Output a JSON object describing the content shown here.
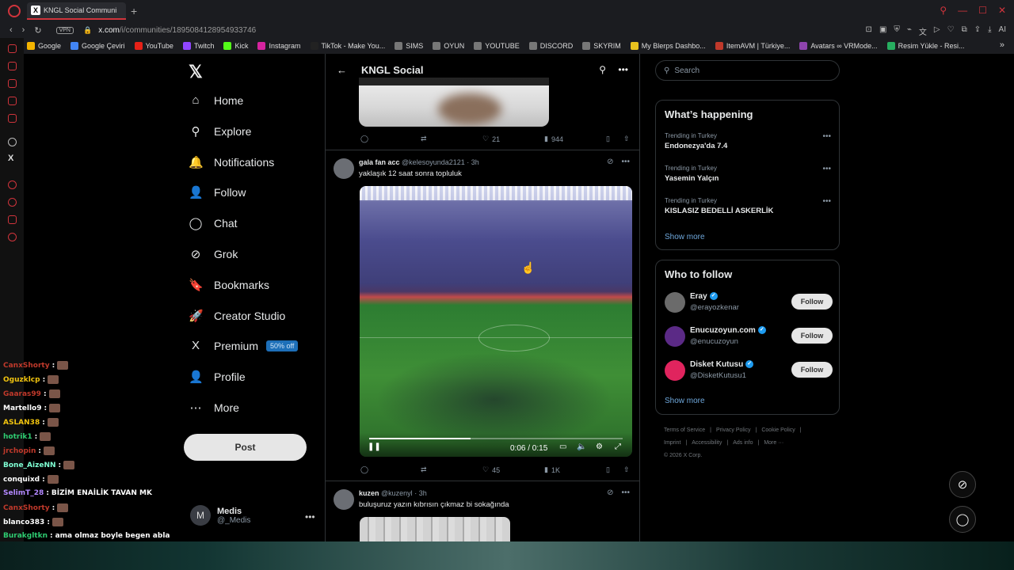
{
  "browser": {
    "tab_title": "KNGL Social Communi",
    "url_main": "x.com",
    "url_rest": "/i/communities/1895084128954933746",
    "vpn_label": "VPN",
    "ai_label": "AI",
    "bookmarks": [
      {
        "label": "Google",
        "color": "#f4b400"
      },
      {
        "label": "Google Çeviri",
        "color": "#4285f4"
      },
      {
        "label": "YouTube",
        "color": "#e62117"
      },
      {
        "label": "Twitch",
        "color": "#9146ff"
      },
      {
        "label": "Kick",
        "color": "#53fc18"
      },
      {
        "label": "Instagram",
        "color": "#d6249f"
      },
      {
        "label": "TikTok - Make You...",
        "color": "#222222"
      },
      {
        "label": "SIMS",
        "color": "#777777"
      },
      {
        "label": "OYUN",
        "color": "#777777"
      },
      {
        "label": "YOUTUBE",
        "color": "#777777"
      },
      {
        "label": "DISCORD",
        "color": "#777777"
      },
      {
        "label": "SKYRIM",
        "color": "#777777"
      },
      {
        "label": "My Blerps Dashbo...",
        "color": "#e8c21e"
      },
      {
        "label": "ItemAVM | Türkiye...",
        "color": "#c0392b"
      },
      {
        "label": "Avatars ∞ VRMode...",
        "color": "#8e44ad"
      },
      {
        "label": "Resim Yükle - Resi...",
        "color": "#27ae60"
      }
    ]
  },
  "nav": {
    "items": [
      {
        "label": "Home",
        "icon": "home-icon",
        "glyph": "⌂"
      },
      {
        "label": "Explore",
        "icon": "search-icon",
        "glyph": "⚲"
      },
      {
        "label": "Notifications",
        "icon": "bell-icon",
        "glyph": "🔔"
      },
      {
        "label": "Follow",
        "icon": "follow-icon",
        "glyph": "👤"
      },
      {
        "label": "Chat",
        "icon": "chat-icon",
        "glyph": "◯"
      },
      {
        "label": "Grok",
        "icon": "grok-icon",
        "glyph": "⊘"
      },
      {
        "label": "Bookmarks",
        "icon": "bookmark-icon",
        "glyph": "🔖"
      },
      {
        "label": "Creator Studio",
        "icon": "rocket-icon",
        "glyph": "🚀"
      },
      {
        "label": "Premium",
        "icon": "x-icon",
        "glyph": "X"
      },
      {
        "label": "Profile",
        "icon": "profile-icon",
        "glyph": "👤"
      },
      {
        "label": "More",
        "icon": "more-icon",
        "glyph": "⋯"
      }
    ],
    "premium_badge": "50% off",
    "post_label": "Post",
    "account_name": "Medis",
    "account_handle": "@_Medis",
    "account_initial": "M"
  },
  "timeline": {
    "header_title": "KNGL Social",
    "top_post_stats": {
      "likes": "21",
      "views": "944"
    },
    "tweet1": {
      "name": "gala fan acc",
      "handle": "@kelesoyunda2121",
      "time": "· 3h",
      "text": "yaklaşık 12 saat sonra topluluk",
      "video_time": "0:06 / 0:15",
      "progress": 0.4,
      "likes": "45",
      "views": "1K"
    },
    "tweet2": {
      "name": "kuzen",
      "handle": "@kuzenyl",
      "time": "· 3h",
      "text": "buluşuruz yazın kıbrısın çıkmaz bi sokağında"
    }
  },
  "right": {
    "search_placeholder": "Search",
    "whats_happening": "What’s happening",
    "trends": [
      {
        "context": "Trending in Turkey",
        "title": "Endonezya'da 7.4"
      },
      {
        "context": "Trending in Turkey",
        "title": "Yasemin Yalçın"
      },
      {
        "context": "Trending in Turkey",
        "title": "KISLASIZ BEDELLİ ASKERLİK"
      }
    ],
    "show_more": "Show more",
    "who_to_follow": "Who to follow",
    "follow_label": "Follow",
    "suggestions": [
      {
        "name": "Eray",
        "handle": "@erayozkenar",
        "color": "#6b6b6b"
      },
      {
        "name": "Enucuzoyun.com",
        "handle": "@enucuzoyun",
        "color": "#5b2a86"
      },
      {
        "name": "Disket Kutusu",
        "handle": "@DisketKutusu1",
        "color": "#e0245e"
      }
    ],
    "footer": [
      "Terms of Service",
      "|",
      "Privacy Policy",
      "|",
      "Cookie Policy",
      "|",
      "Imprint",
      "|",
      "Accessibility",
      "|",
      "Ads info",
      "|",
      "More ···",
      "© 2026 X Corp."
    ]
  },
  "chat": [
    {
      "user": "CanxShorty",
      "color": "#c0392b",
      "msg": ""
    },
    {
      "user": "Oguzklcp",
      "color": "#f1c40f",
      "msg": ""
    },
    {
      "user": "Gaaras99",
      "color": "#c0392b",
      "msg": ""
    },
    {
      "user": "Martello9",
      "color": "#ffffff",
      "msg": ""
    },
    {
      "user": "ASLAN38",
      "color": "#f1c40f",
      "msg": ""
    },
    {
      "user": "hotrik1",
      "color": "#2ecc71",
      "msg": ""
    },
    {
      "user": "jrchopin",
      "color": "#c0392b",
      "msg": ""
    },
    {
      "user": "Bone_AizeNN",
      "color": "#7fffd4",
      "msg": ""
    },
    {
      "user": "conquixd",
      "color": "#ffffff",
      "msg": ""
    },
    {
      "user": "SelimT_28",
      "color": "#b388ff",
      "msg": "BİZİM ENAİLİK TAVAN MK"
    },
    {
      "user": "CanxShorty",
      "color": "#c0392b",
      "msg": ""
    },
    {
      "user": "blanco383",
      "color": "#ffffff",
      "msg": ""
    },
    {
      "user": "Burakgltkn",
      "color": "#2ecc71",
      "msg": "ama olmaz boyle begen abla"
    }
  ]
}
